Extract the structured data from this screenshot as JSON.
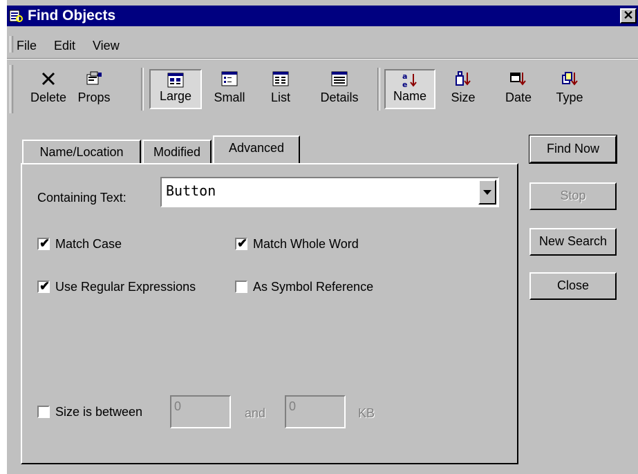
{
  "window": {
    "title": "Find Objects",
    "close_glyph": "✕"
  },
  "menu": {
    "items": [
      "File",
      "Edit",
      "View"
    ]
  },
  "toolbar": {
    "buttons": [
      {
        "label": "Delete",
        "icon": "delete-x-icon"
      },
      {
        "label": "Props",
        "icon": "properties-icon"
      },
      {
        "label": "Large",
        "icon": "large-icons-view-icon",
        "pressed": true
      },
      {
        "label": "Small",
        "icon": "small-icons-view-icon"
      },
      {
        "label": "List",
        "icon": "list-view-icon"
      },
      {
        "label": "Details",
        "icon": "details-view-icon"
      },
      {
        "label": "Name",
        "icon": "sort-name-icon",
        "pressed": true
      },
      {
        "label": "Size",
        "icon": "sort-size-icon"
      },
      {
        "label": "Date",
        "icon": "sort-date-icon"
      },
      {
        "label": "Type",
        "icon": "sort-type-icon"
      }
    ]
  },
  "tabs": [
    {
      "label": "Name/Location",
      "active": false
    },
    {
      "label": "Modified",
      "active": false
    },
    {
      "label": "Advanced",
      "active": true
    }
  ],
  "advanced": {
    "containing_text_label": "Containing Text:",
    "containing_text_value": "Button",
    "match_case": {
      "label": "Match Case",
      "checked": true
    },
    "match_whole_word": {
      "label": "Match Whole Word",
      "checked": true
    },
    "use_regex": {
      "label": "Use Regular Expressions",
      "checked": true
    },
    "symbol_ref": {
      "label": "As Symbol Reference",
      "checked": false
    },
    "size_between": {
      "label": "Size is between",
      "checked": false
    },
    "size_min": "0",
    "size_and": "and",
    "size_max": "0",
    "size_unit": "KB",
    "check_glyph": "✔"
  },
  "buttons": {
    "find_now": "Find Now",
    "stop": "Stop",
    "new_search": "New Search",
    "close": "Close"
  },
  "colors": {
    "titlebar": "#000080",
    "face": "#c0c0c0",
    "sort_arrow": "#8b0000"
  }
}
